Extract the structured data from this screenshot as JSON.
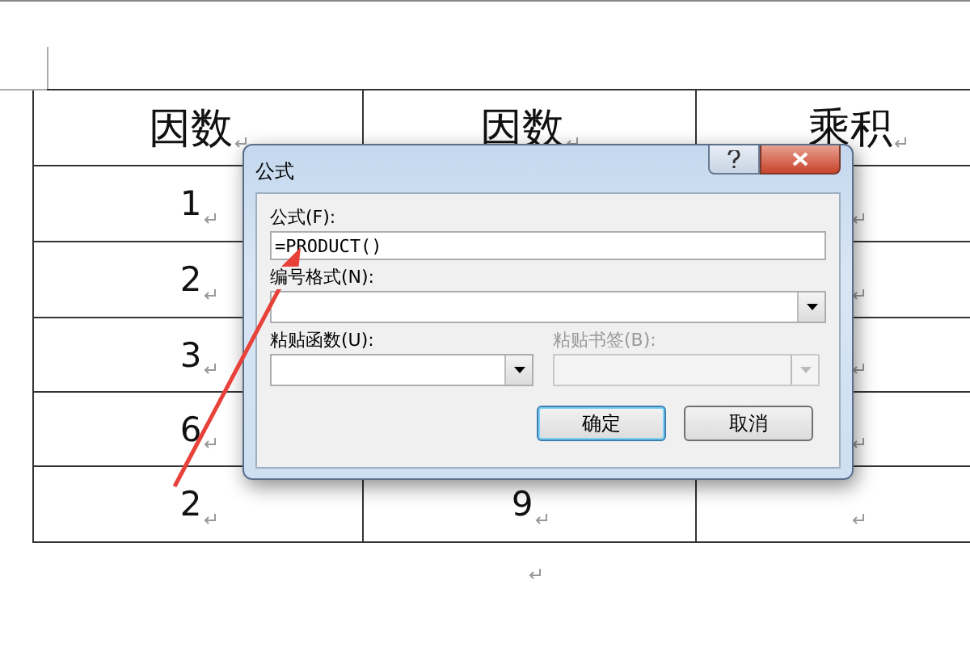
{
  "table": {
    "header": [
      "因数",
      "因数",
      "乘积"
    ],
    "rows": [
      [
        "1",
        "",
        ""
      ],
      [
        "2",
        "",
        ""
      ],
      [
        "3",
        "",
        ""
      ],
      [
        "6",
        "",
        ""
      ],
      [
        "2",
        "9",
        ""
      ]
    ]
  },
  "dialog": {
    "title": "公式",
    "formula_label": "公式(F):",
    "formula_value": "=PRODUCT()",
    "number_format_label": "编号格式(N):",
    "paste_function_label": "粘贴函数(U):",
    "paste_bookmark_label": "粘贴书签(B):",
    "paste_bookmark_disabled": true,
    "buttons": [
      {
        "label": "确定",
        "default": true
      },
      {
        "label": "取消",
        "default": false
      }
    ]
  }
}
